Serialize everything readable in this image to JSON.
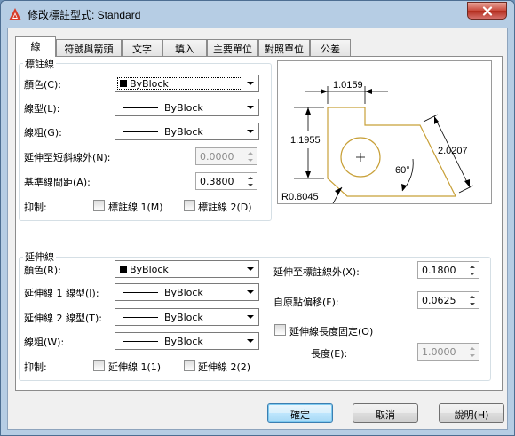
{
  "window": {
    "title": "修改標註型式: Standard",
    "tabs": [
      "線",
      "符號與箭頭",
      "文字",
      "填入",
      "主要單位",
      "對照單位",
      "公差"
    ]
  },
  "dimlines": {
    "legend": "標註線",
    "color_label": "顏色(C):",
    "color_value": "ByBlock",
    "linetype_label": "線型(L):",
    "linetype_value": "ByBlock",
    "lineweight_label": "線粗(G):",
    "lineweight_value": "ByBlock",
    "extend_ticks_label": "延伸至短斜線外(N):",
    "extend_ticks_value": "0.0000",
    "baseline_spacing_label": "基準線間距(A):",
    "baseline_spacing_value": "0.3800",
    "suppress_label": "抑制:",
    "suppress_1": "標註線 1(M)",
    "suppress_2": "標註線 2(D)"
  },
  "preview": {
    "dim_top": "1.0159",
    "dim_left": "1.1955",
    "dim_right": "2.0207",
    "angle": "60°",
    "radius": "R0.8045"
  },
  "extlines": {
    "legend": "延伸線",
    "color_label": "顏色(R):",
    "color_value": "ByBlock",
    "linetype1_label": "延伸線 1 線型(I):",
    "linetype1_value": "ByBlock",
    "linetype2_label": "延伸線 2 線型(T):",
    "linetype2_value": "ByBlock",
    "lineweight_label": "線粗(W):",
    "lineweight_value": "ByBlock",
    "suppress_label": "抑制:",
    "suppress_1": "延伸線 1(1)",
    "suppress_2": "延伸線 2(2)",
    "extend_beyond_label": "延伸至標註線外(X):",
    "extend_beyond_value": "0.1800",
    "offset_label": "自原點偏移(F):",
    "offset_value": "0.0625",
    "fixed_length_label": "延伸線長度固定(O)",
    "length_label": "長度(E):",
    "length_value": "1.0000"
  },
  "buttons": {
    "ok": "確定",
    "cancel": "取消",
    "help": "說明(H)"
  },
  "colors": {
    "preview_geometry": "#c8a038",
    "accent_red": "#d63c2a"
  }
}
